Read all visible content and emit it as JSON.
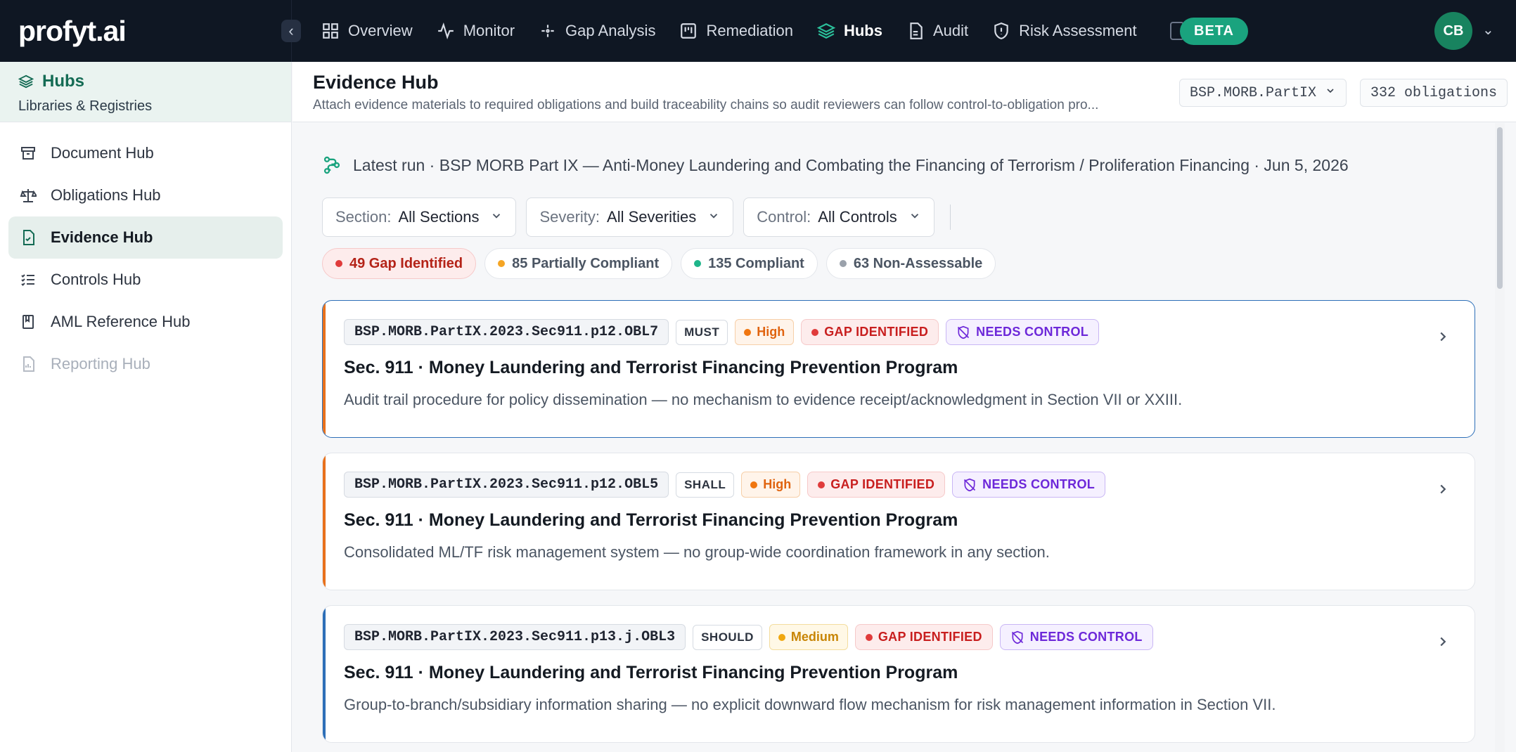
{
  "app": {
    "logo": "profyt.ai"
  },
  "nav": {
    "items": [
      {
        "label": "Overview",
        "icon": "grid-icon",
        "active": false
      },
      {
        "label": "Monitor",
        "icon": "activity-icon",
        "active": false
      },
      {
        "label": "Gap Analysis",
        "icon": "sparkle-icon",
        "active": false
      },
      {
        "label": "Remediation",
        "icon": "kanban-icon",
        "active": false
      },
      {
        "label": "Hubs",
        "icon": "layers-icon",
        "active": true
      },
      {
        "label": "Audit",
        "icon": "file-icon",
        "active": false
      },
      {
        "label": "Risk Assessment",
        "icon": "shield-icon",
        "active": false
      }
    ],
    "beta_label": "BETA",
    "user_initials": "CB"
  },
  "sidebar": {
    "title": "Hubs",
    "subtitle": "Libraries & Registries",
    "items": [
      {
        "label": "Document Hub",
        "icon": "archive-icon",
        "state": "normal"
      },
      {
        "label": "Obligations Hub",
        "icon": "scale-icon",
        "state": "normal"
      },
      {
        "label": "Evidence Hub",
        "icon": "file-check-icon",
        "state": "active"
      },
      {
        "label": "Controls Hub",
        "icon": "list-check-icon",
        "state": "normal"
      },
      {
        "label": "AML Reference Hub",
        "icon": "book-icon",
        "state": "normal"
      },
      {
        "label": "Reporting Hub",
        "icon": "report-icon",
        "state": "disabled"
      }
    ]
  },
  "header": {
    "title": "Evidence Hub",
    "description": "Attach evidence materials to required obligations and build traceability chains so audit reviewers can follow control-to-obligation pro...",
    "regulation": "BSP.MORB.PartIX",
    "obligation_count": "332 obligations"
  },
  "run": {
    "text": "Latest run · BSP MORB Part IX — Anti-Money Laundering and Combating the Financing of Terrorism / Proliferation Financing · Jun 5, 2026"
  },
  "filters": [
    {
      "label": "Section:",
      "value": "All Sections"
    },
    {
      "label": "Severity:",
      "value": "All Severities"
    },
    {
      "label": "Control:",
      "value": "All Controls"
    }
  ],
  "summary_pills": [
    {
      "label": "49 Gap Identified",
      "dot_color": "#e03b3b",
      "style": "gap"
    },
    {
      "label": "85 Partially Compliant",
      "dot_color": "#f5a524",
      "style": "normal"
    },
    {
      "label": "135 Compliant",
      "dot_color": "#1fb58a",
      "style": "normal"
    },
    {
      "label": "63 Non-Assessable",
      "dot_color": "#9aa1ab",
      "style": "normal"
    }
  ],
  "cards": [
    {
      "id": "BSP.MORB.PartIX.2023.Sec911.p12.OBL7",
      "modality": "MUST",
      "severity": "High",
      "status": "GAP IDENTIFIED",
      "needs": "NEEDS CONTROL",
      "title": "Sec. 911 · Money Laundering and Terrorist Financing Prevention Program",
      "description": "Audit trail procedure for policy dissemination — no mechanism to evidence receipt/acknowledgment in Section VII or XXIII.",
      "accent_color": "#e8711c",
      "selected": true
    },
    {
      "id": "BSP.MORB.PartIX.2023.Sec911.p12.OBL5",
      "modality": "SHALL",
      "severity": "High",
      "status": "GAP IDENTIFIED",
      "needs": "NEEDS CONTROL",
      "title": "Sec. 911 · Money Laundering and Terrorist Financing Prevention Program",
      "description": "Consolidated ML/TF risk management system — no group-wide coordination framework in any section.",
      "accent_color": "#e8711c",
      "selected": false
    },
    {
      "id": "BSP.MORB.PartIX.2023.Sec911.p13.j.OBL3",
      "modality": "SHOULD",
      "severity": "Medium",
      "status": "GAP IDENTIFIED",
      "needs": "NEEDS CONTROL",
      "title": "Sec. 911 · Money Laundering and Terrorist Financing Prevention Program",
      "description": "Group-to-branch/subsidiary information sharing — no explicit downward flow mechanism for risk management information in Section VII.",
      "accent_color": "#2d6fb8",
      "selected": false
    }
  ],
  "colors": {
    "brand_green": "#1aa37e",
    "nav_bg": "#0f1723",
    "high": "#e8711c",
    "medium": "#d89614",
    "gap_red": "#c81e1e",
    "needs_purple": "#6d28d9"
  }
}
